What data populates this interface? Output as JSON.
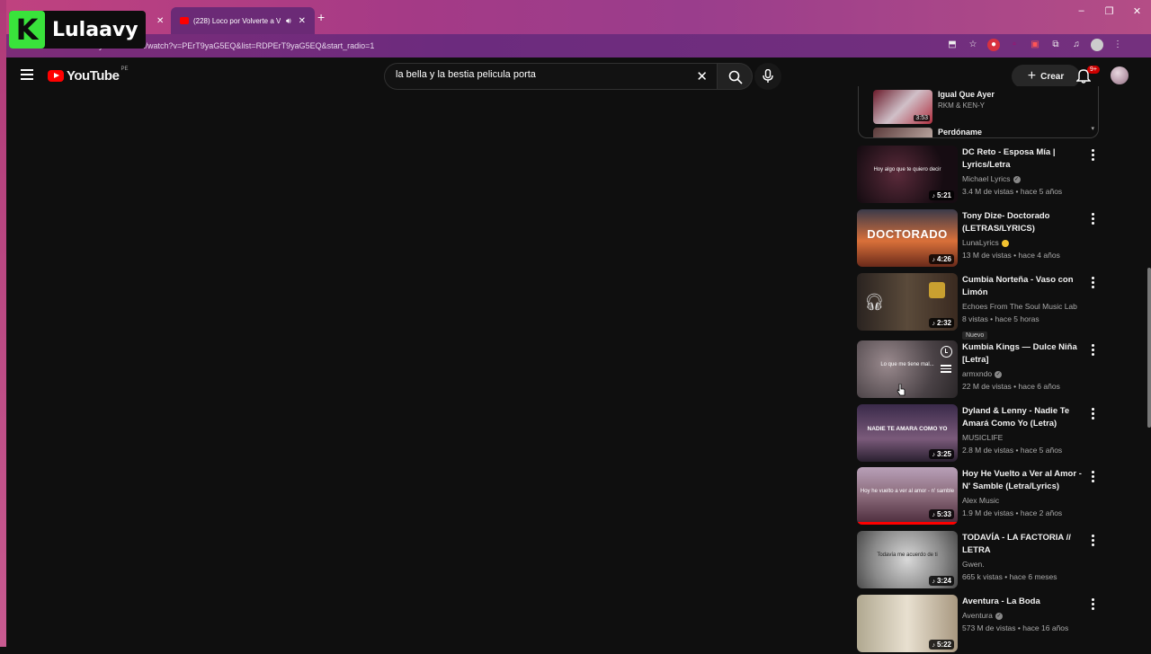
{
  "watermark": {
    "logo_letter": "K",
    "text": "Lulaavy"
  },
  "browser": {
    "active_tab_title": "(228) Loco por Volverte a V",
    "url": "youtube.com/watch?v=PErT9yaG5EQ&list=RDPErT9yaG5EQ&start_radio=1",
    "window_controls": [
      "–",
      "❐",
      "✕"
    ]
  },
  "header": {
    "logo_text": "YouTube",
    "country_code": "PE",
    "search_value": "la bella y la bestia pelicula porta",
    "create_label": "Crear",
    "notification_count": "9+"
  },
  "playlist": {
    "items": [
      {
        "title": "Igual Que Ayer",
        "channel": "RKM & KEN-Y",
        "duration": "3:53"
      },
      {
        "title": "Perdóname",
        "channel": "",
        "duration": ""
      }
    ]
  },
  "recommended": [
    {
      "title": "DC Reto - Esposa Mía | Lyrics/Letra",
      "channel": "Michael Lyrics",
      "verified": true,
      "stats": "3.4 M de vistas • hace 5 años",
      "duration": "5:21",
      "thumb_caption": "Hoy algo que te quiero decir",
      "thumb_color": "#2a1a22"
    },
    {
      "title": "Tony Dize- Doctorado (LETRAS/LYRICS)",
      "channel": "LunaLyrics",
      "emoji": true,
      "stats": "13 M de vistas • hace 4 años",
      "duration": "4:26",
      "thumb_caption": "DOCTORADO",
      "thumb_color": "#c4623a"
    },
    {
      "title": "Cumbia Norteña - Vaso con Limón",
      "channel": "Echoes From The Soul Music Lab",
      "stats": "8 vistas • hace 5 horas",
      "badge": "Nuevo",
      "duration": "2:32",
      "thumb_caption": "",
      "thumb_color": "#3a2f28"
    },
    {
      "title": "Kumbia Kings — Dulce Niña [Letra]",
      "channel": "armxndo",
      "verified": true,
      "stats": "22 M de vistas • hace 6 años",
      "duration": "",
      "thumb_caption": "Lo que me tiene mal...",
      "thumb_color": "#5a5458"
    },
    {
      "title": "Dyland & Lenny - Nadie Te Amará Como Yo (Letra)",
      "channel": "MUSICLIFE",
      "stats": "2.8 M de vistas • hace 5 años",
      "duration": "3:25",
      "thumb_caption": "NADIE TE AMARA COMO YO",
      "thumb_color": "#4a3a5a"
    },
    {
      "title": "Hoy He Vuelto a Ver al Amor - N' Samble (Letra/Lyrics)",
      "channel": "Alex Music",
      "stats": "1.9 M de vistas • hace 2 años",
      "duration": "5:33",
      "thumb_caption": "Hoy he vuelto a ver al amor - n' samble",
      "thumb_color": "#7a5a6a"
    },
    {
      "title": "TODAVÍA - LA FACTORIA // LETRA",
      "channel": "Gwen.",
      "stats": "665 k vistas • hace 6 meses",
      "duration": "3:24",
      "thumb_caption": "Todavía me acuerdo de ti",
      "thumb_color": "#8a8a8a"
    },
    {
      "title": "Aventura - La Boda",
      "channel": "Aventura",
      "verified": true,
      "stats": "573 M de vistas • hace 16 años",
      "duration": "5:22",
      "thumb_caption": "",
      "thumb_color": "#c9c0b0"
    }
  ]
}
